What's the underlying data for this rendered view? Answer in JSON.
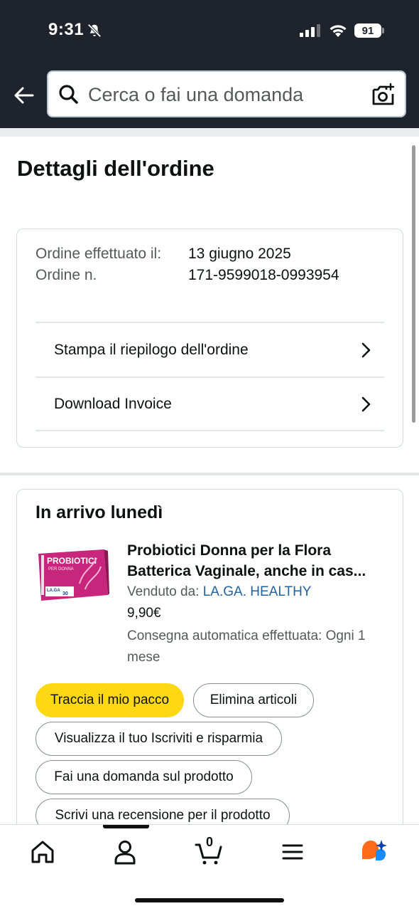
{
  "status_bar": {
    "time": "9:31",
    "battery": "91"
  },
  "header": {
    "search_placeholder": "Cerca o fai una domanda"
  },
  "page": {
    "title": "Dettagli dell'ordine"
  },
  "order_info": {
    "placed_label": "Ordine effettuato il:",
    "placed_value": "13 giugno 2025",
    "number_label": "Ordine n.",
    "number_value": "171-9599018-0993954",
    "actions": [
      "Stampa il riepilogo dell'ordine",
      "Download Invoice"
    ]
  },
  "shipment": {
    "title": "In arrivo lunedì",
    "product_title": "Probiotici Donna per la Flora Batterica Vaginale, anche in cas...",
    "sold_by_label": "Venduto da:",
    "seller": "LA.GA. HEALTHY",
    "price": "9,90€",
    "auto_delivery": "Consegna automatica effettuata: Ogni 1 mese",
    "buttons": {
      "track": "Traccia il mio pacco",
      "delete": "Elimina articoli",
      "subscribe": "Visualizza il tuo Iscriviti e risparmia",
      "question": "Fai una domanda sul prodotto",
      "review": "Scrivi una recensione per il prodotto"
    }
  },
  "product_image_text": {
    "brand": "PROBIOTICI",
    "sub": "PER DONNA",
    "maker": "LA.GA",
    "count": "30"
  },
  "bottom_nav": {
    "cart_count": "0"
  }
}
